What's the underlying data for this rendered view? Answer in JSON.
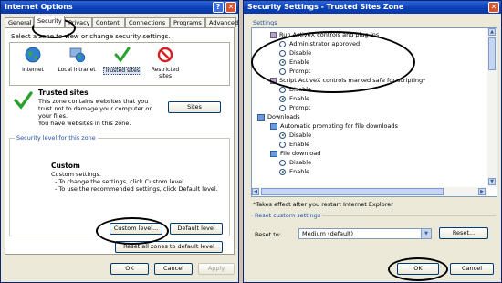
{
  "left": {
    "title": "Internet Options",
    "tabs": [
      "General",
      "Security",
      "Privacy",
      "Content",
      "Connections",
      "Programs",
      "Advanced"
    ],
    "zone_prompt": "Select a zone to view or change security settings.",
    "zones": [
      "Internet",
      "Local intranet",
      "Trusted sites",
      "Restricted sites"
    ],
    "zone_title": "Trusted sites",
    "zone_desc": [
      "This zone contains websites that you",
      "trust not to damage your computer or",
      "your files.",
      "You have websites in this zone."
    ],
    "sites_button": "Sites",
    "level_group": "Security level for this zone",
    "level_title": "Custom",
    "level_desc": [
      "Custom settings.",
      "- To change the settings, click Custom level.",
      "- To use the recommended settings, click Default level."
    ],
    "custom_button": "Custom level...",
    "default_button": "Default level",
    "reset_all_button": "Reset all zones to default level",
    "ok": "OK",
    "cancel": "Cancel",
    "apply": "Apply"
  },
  "right": {
    "title": "Security Settings - Trusted Sites Zone",
    "settings_label": "Settings",
    "tree": [
      {
        "type": "cat",
        "text": "Run ActiveX controls and plug-ins"
      },
      {
        "type": "opt",
        "text": "Administrator approved",
        "on": false
      },
      {
        "type": "opt",
        "text": "Disable",
        "on": false
      },
      {
        "type": "opt",
        "text": "Enable",
        "on": true
      },
      {
        "type": "opt",
        "text": "Prompt",
        "on": false
      },
      {
        "type": "cat",
        "text": "Script ActiveX controls marked safe for scripting*"
      },
      {
        "type": "opt",
        "text": "Disable",
        "on": false
      },
      {
        "type": "opt",
        "text": "Enable",
        "on": true
      },
      {
        "type": "opt",
        "text": "Prompt",
        "on": false
      },
      {
        "type": "dlcat",
        "text": "Downloads"
      },
      {
        "type": "sub",
        "text": "Automatic prompting for file downloads"
      },
      {
        "type": "opt2",
        "text": "Disable",
        "on": true
      },
      {
        "type": "opt2",
        "text": "Enable",
        "on": false
      },
      {
        "type": "sub",
        "text": "File download"
      },
      {
        "type": "opt2",
        "text": "Disable",
        "on": false
      },
      {
        "type": "opt2",
        "text": "Enable",
        "on": true
      }
    ],
    "note": "*Takes effect after you restart Internet Explorer",
    "reset_group": "Reset custom settings",
    "reset_to_label": "Reset to:",
    "reset_select": "Medium (default)",
    "reset_button": "Reset...",
    "ok": "OK",
    "cancel": "Cancel"
  }
}
